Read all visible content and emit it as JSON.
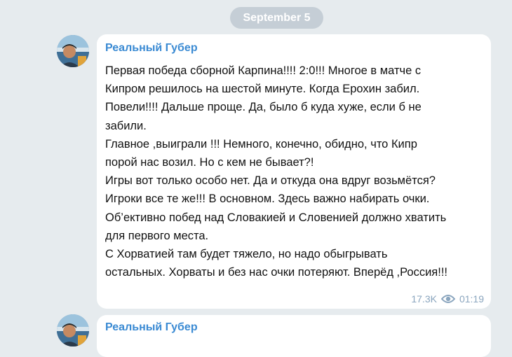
{
  "date_separator": "September 5",
  "messages": [
    {
      "author": "Реальный Губер",
      "lines": [
        "Первая победа сборной Карпина!!!! 2:0!!! Многое в матче с",
        "Кипром решилось на шестой минуте. Когда Ерохин забил.",
        "Повели!!!! Дальше проще. Да, было б куда хуже, если б не",
        "забили.",
        "Главное ,выиграли !!! Немного, конечно, обидно, что Кипр",
        "порой нас возил. Но с кем не бывает?!",
        "Игры вот только особо нет. Да и откуда она вдруг возьмётся?",
        "Игроки все те же!!! В основном. Здесь важно набирать очки.",
        "Об’ективно побед над Словакией и Словенией должно хватить",
        "для первого места.",
        "С Хорватией там будет тяжело, но надо обыгрывать",
        "остальных. Хорваты и без нас очки потеряют. Вперёд ,Россия!!!"
      ],
      "views": "17.3K",
      "time": "01:19",
      "views_icon": "eye-icon"
    },
    {
      "author": "Реальный Губер"
    }
  ],
  "colors": {
    "background": "#e6ebee",
    "author": "#3a8ad3",
    "meta": "#8aa5be",
    "date_pill": "#c5ced6"
  }
}
